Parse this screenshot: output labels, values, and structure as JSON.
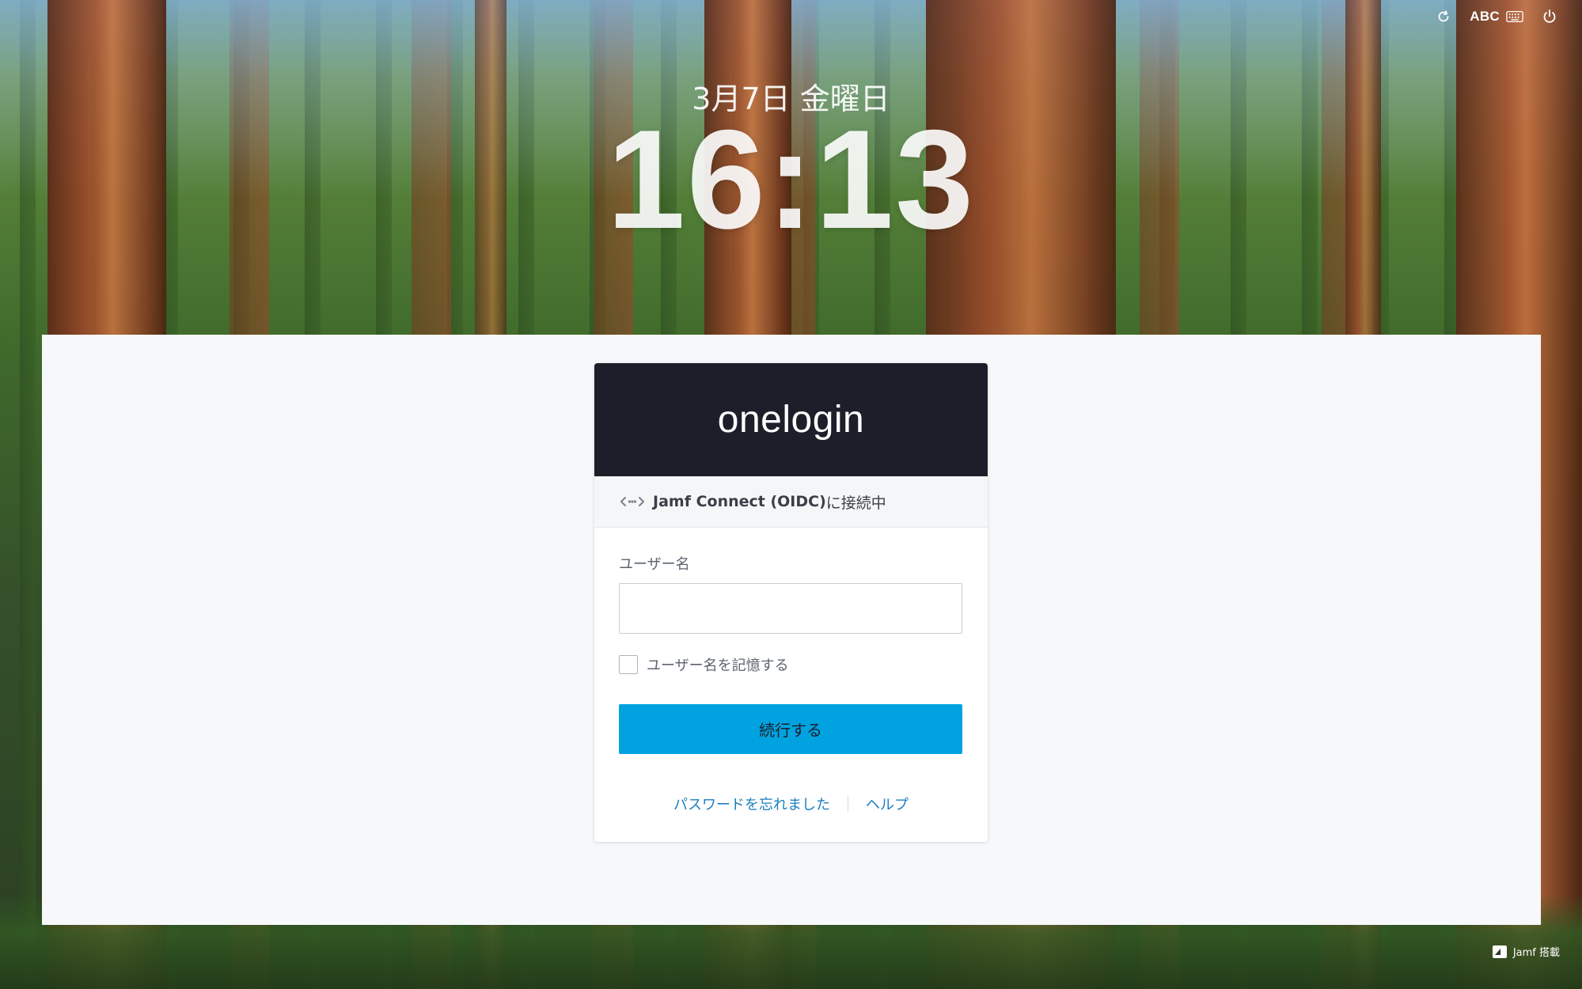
{
  "statusbar": {
    "reload_icon": "reload-icon",
    "input_source": "ABC",
    "keyboard_icon": "keyboard-icon",
    "power_icon": "power-icon"
  },
  "lockscreen": {
    "date": "3月7日 金曜日",
    "time": "16:13"
  },
  "login": {
    "brand": "onelogin",
    "connect_icon": "arrows-connect-icon",
    "connect_app": "Jamf Connect (OIDC)",
    "connect_suffix": "に接続中",
    "username_label": "ユーザー名",
    "username_value": "",
    "remember_label": "ユーザー名を記憶する",
    "remember_checked": false,
    "continue_label": "続行する",
    "forgot_password": "パスワードを忘れました",
    "help": "ヘルプ",
    "accent_color": "#00a3e0",
    "header_color": "#1c1f2a"
  },
  "footer": {
    "badge": "Jamf 搭載",
    "logo_icon": "jamf-logo-icon"
  }
}
